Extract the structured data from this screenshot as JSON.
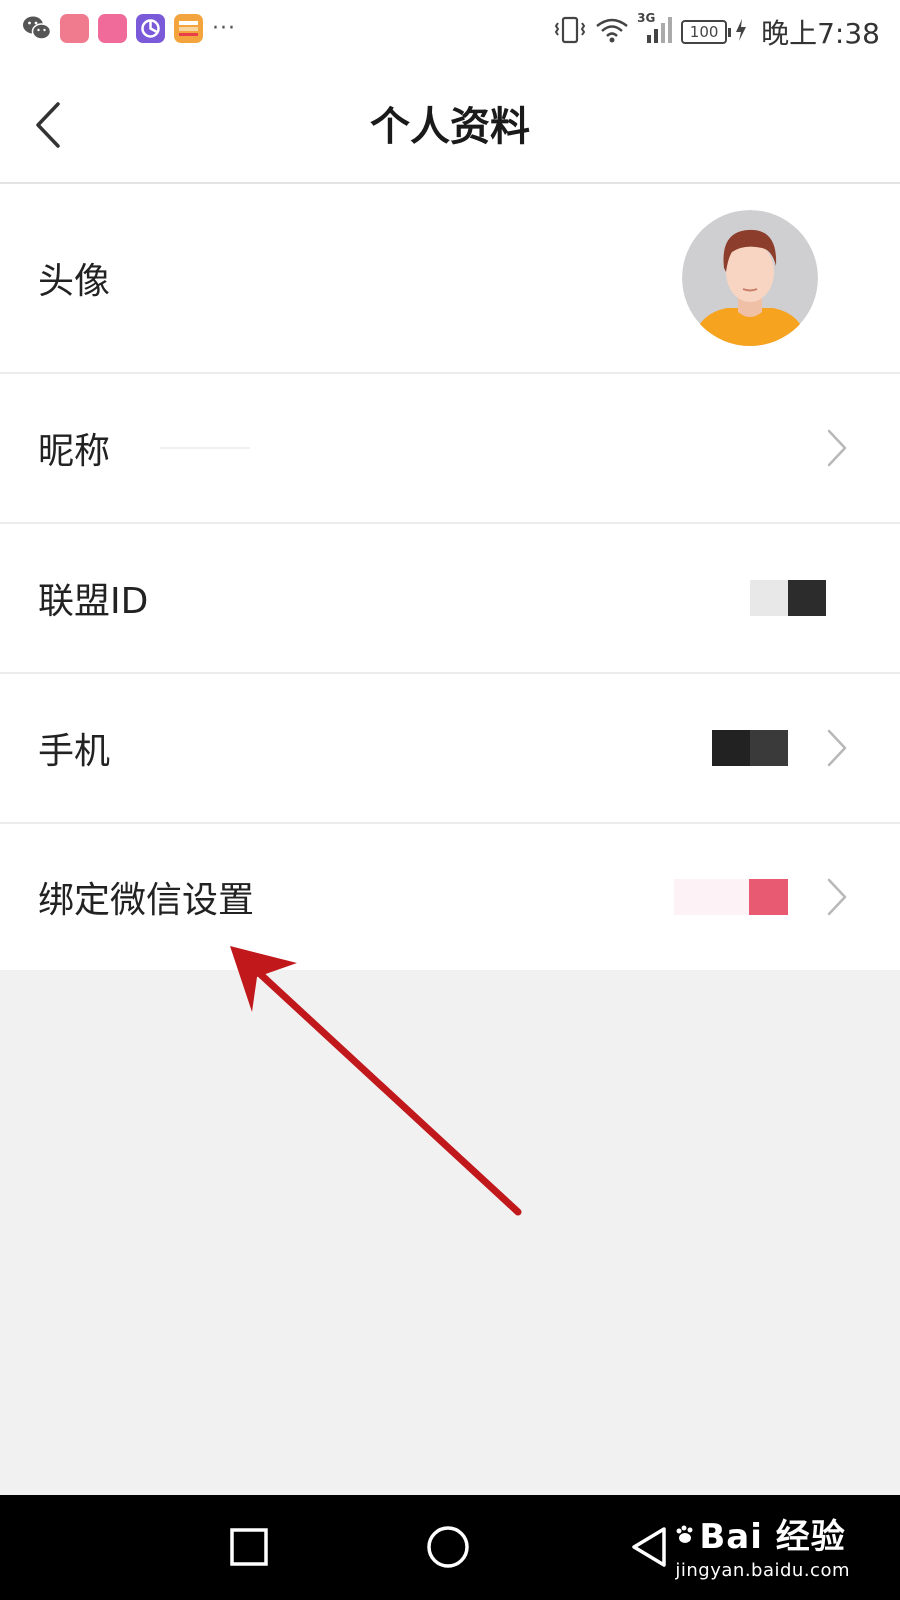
{
  "status_bar": {
    "time": "晚上7:38",
    "battery": "100",
    "network": "3G",
    "app_icons": [
      "wechat-icon",
      "app-icon-1",
      "app-icon-2",
      "app-icon-3",
      "app-icon-4"
    ],
    "more": "···"
  },
  "header": {
    "title": "个人资料"
  },
  "profile": {
    "rows": [
      {
        "label": "头像"
      },
      {
        "label": "昵称"
      },
      {
        "label": "联盟ID"
      },
      {
        "label": "手机"
      },
      {
        "label": "绑定微信设置"
      }
    ]
  },
  "watermark": {
    "brand": "Bai 经验",
    "url": "jingyan.baidu.com"
  },
  "colors": {
    "annotation_arrow": "#c0181b",
    "background": "#f2f1f2",
    "censor_pink": "#e85a72"
  }
}
